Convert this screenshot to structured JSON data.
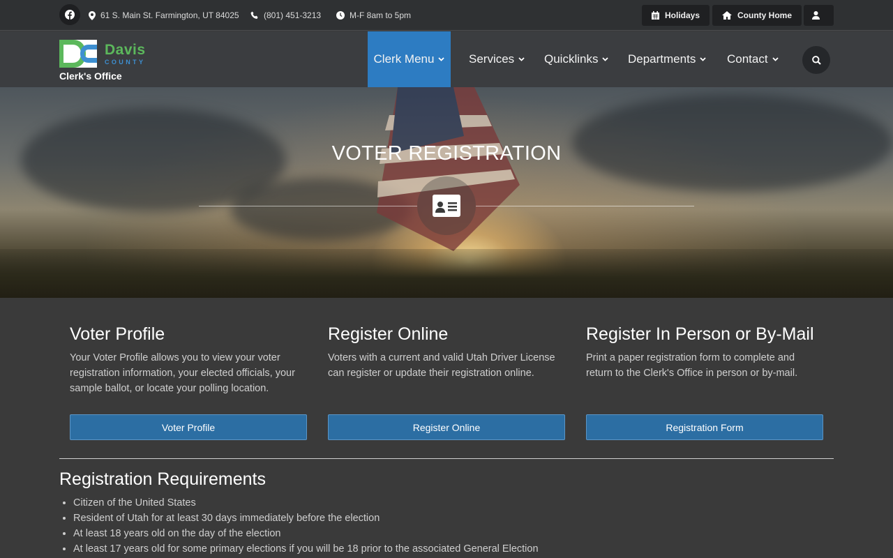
{
  "topbar": {
    "address": "61 S. Main St. Farmington, UT 84025",
    "phone": "(801) 451-3213",
    "hours": "M-F 8am to 5pm",
    "holidays_label": "Holidays",
    "county_home_label": "County Home"
  },
  "header": {
    "logo_name": "Davis",
    "logo_county": "COUNTY",
    "office_label": "Clerk's Office",
    "nav": [
      "Clerk Menu",
      "Services",
      "Quicklinks",
      "Departments",
      "Contact"
    ],
    "active_nav": "Clerk Menu"
  },
  "hero": {
    "title": "VOTER REGISTRATION",
    "icon": "id-card-icon"
  },
  "cards": [
    {
      "title": "Voter Profile",
      "text": "Your Voter Profile allows you to view your voter registration information, your elected officials, your sample ballot, or locate your polling location.",
      "button": "Voter Profile"
    },
    {
      "title": "Register Online",
      "text": "Voters with a current and valid Utah Driver License can register or update their registration online.",
      "button": "Register Online"
    },
    {
      "title": "Register In Person or By-Mail",
      "text": "Print a paper registration form to complete and return to the Clerk's Office in person or by-mail.",
      "button": "Registration Form"
    }
  ],
  "requirements": {
    "title": "Registration Requirements",
    "items": [
      "Citizen of the United States",
      "Resident of Utah for at least 30 days immediately before the election",
      "At least 18 years old on the day of the election",
      "At least 17 years old for some primary elections if you will be 18 prior to the associated General Election"
    ]
  },
  "colors": {
    "accent": "#2d7cc2",
    "button": "#2c6ea3",
    "logo_green": "#5cb85c",
    "logo_blue": "#3d8fd1"
  }
}
